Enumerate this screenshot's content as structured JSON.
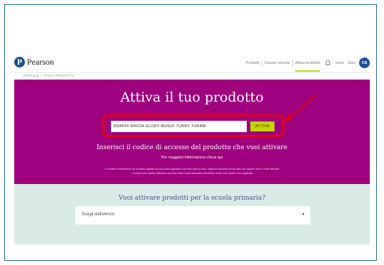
{
  "brand": {
    "name": "Pearson",
    "logo_letter": "P",
    "color": "#1d4f91"
  },
  "nav": {
    "items": [
      "Prodotti",
      "Classe virtuale",
      "Attiva prodotto"
    ],
    "help": "Help",
    "logout": "Esci",
    "avatar_initials": "FB",
    "active_item": "Attiva prodotto"
  },
  "breadcrumb": "PORTALE > ATTIVA PRODOTTO",
  "hero": {
    "title": "Attiva il tuo prodotto",
    "code_value": "8SIMSP-RAFDA GLORY BENUF TURBY THRAW",
    "activate_label": "ATTIVA",
    "subtitle": "Inserisci il codice di accesso del prodotto che vuoi attivare",
    "info_link": "Per maggiori informazioni clicca qui",
    "note_1": "• Il codice di attivazione del prodotto digitale si trova sulla copertina o sul retro del tuo libro. Segui le istruzioni sul tuo libro per sapere dove e come attivarlo",
    "note_2": "• Il codice può essere utilizzato una sola volta e sarà associato all'indirizzo email con il quale ti sei registrato",
    "background": "#9e007e",
    "button_color": "#c4d600",
    "highlight_color": "#e60012"
  },
  "primary": {
    "title": "Vuoi attivare prodotti per la scuola primaria?",
    "select_value": "Scegli dall'elenco",
    "background": "#d8ebe7"
  }
}
